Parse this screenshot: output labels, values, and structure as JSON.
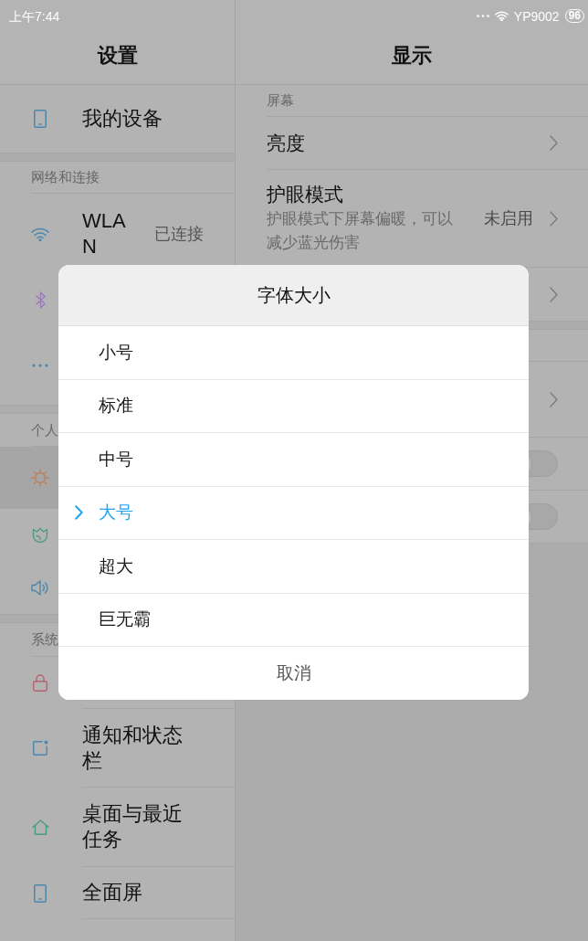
{
  "status_bar": {
    "time": "上午7:44",
    "network_name": "YP9002",
    "battery": "96"
  },
  "sidebar": {
    "title": "设置",
    "sections": [
      {
        "items": [
          {
            "label": "我的设备",
            "selected": false
          }
        ]
      },
      {
        "header": "网络和连接",
        "items": [
          {
            "label": "WLAN",
            "value": "已连接",
            "selected": false
          },
          {
            "selected": false
          },
          {
            "selected": false
          }
        ]
      },
      {
        "header": "个人",
        "items": [
          {
            "selected": true
          },
          {
            "selected": false
          },
          {
            "selected": false
          }
        ]
      },
      {
        "header": "系统",
        "items": [
          {
            "selected": false
          },
          {
            "label": "通知和状态栏",
            "selected": false
          },
          {
            "label": "桌面与最近任务",
            "selected": false
          },
          {
            "label": "全面屏",
            "selected": false
          }
        ]
      }
    ]
  },
  "main": {
    "title": "显示",
    "sections": [
      {
        "header": "屏幕",
        "rows": [
          {
            "kind": "link",
            "title": "亮度"
          },
          {
            "kind": "link",
            "title": "护眼模式",
            "subtitle": "护眼模式下屏幕偏暖，可以减少蓝光伤害",
            "value": "未启用"
          },
          {
            "kind": "link"
          }
        ]
      },
      {
        "rows": [
          {
            "kind": "link"
          },
          {
            "kind": "switch",
            "on": false
          },
          {
            "kind": "switch",
            "on": false
          }
        ]
      }
    ]
  },
  "dialog": {
    "title": "字体大小",
    "options": [
      {
        "label": "小号",
        "selected": false
      },
      {
        "label": "标准",
        "selected": false
      },
      {
        "label": "中号",
        "selected": false
      },
      {
        "label": "大号",
        "selected": true
      },
      {
        "label": "超大",
        "selected": false
      },
      {
        "label": "巨无霸",
        "selected": false
      }
    ],
    "cancel": "取消"
  }
}
